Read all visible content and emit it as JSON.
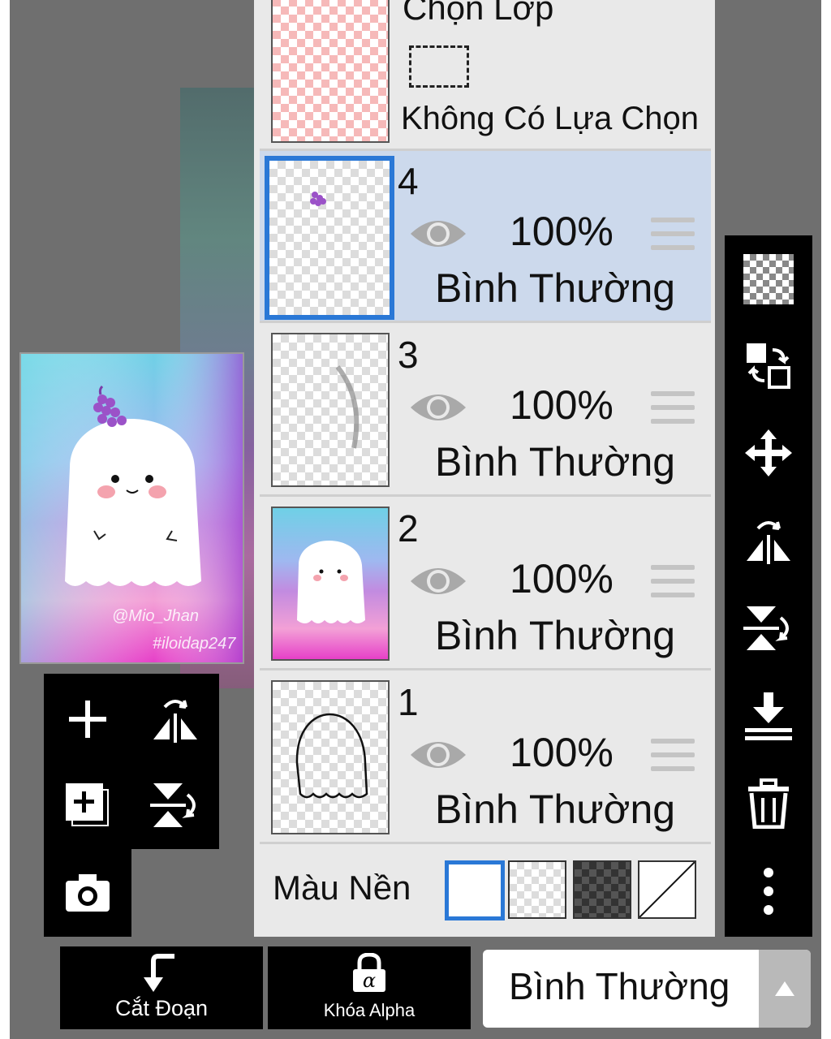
{
  "selection_layer": {
    "title": "Chọn Lớp",
    "status": "Không Có Lựa Chọn"
  },
  "layers": [
    {
      "number": "4",
      "opacity": "100%",
      "blend": "Bình Thường",
      "visible": true,
      "active": true
    },
    {
      "number": "3",
      "opacity": "100%",
      "blend": "Bình Thường",
      "visible": true,
      "active": false
    },
    {
      "number": "2",
      "opacity": "100%",
      "blend": "Bình Thường",
      "visible": true,
      "active": false
    },
    {
      "number": "1",
      "opacity": "100%",
      "blend": "Bình Thường",
      "visible": true,
      "active": false
    }
  ],
  "background_color": {
    "label": "Màu Nền",
    "options": [
      "white",
      "transparent",
      "dark-checker",
      "none"
    ],
    "selected": "white"
  },
  "canvas_preview": {
    "watermark_1": "@Mio_Jhan",
    "watermark_2": "#iloidap247"
  },
  "bottom_bar": {
    "clipping_label": "Cắt Đoạn",
    "alpha_lock_label": "Khóa Alpha",
    "blend_mode_value": "Bình Thường"
  },
  "colors": {
    "accent": "#2a78d6",
    "active_row": "#ccd9ec",
    "panel": "#e9e9e9",
    "toolbar": "#000000"
  },
  "icons": {
    "right_toolbar": [
      "transparent-checker-icon",
      "swap-layers-icon",
      "move-icon",
      "flip-horizontal-icon",
      "flip-vertical-icon",
      "merge-down-icon",
      "trash-icon",
      "more-vertical-icon"
    ],
    "left_toolbar": [
      "add-layer-icon",
      "flip-horizontal-icon",
      "add-duplicate-layer-icon",
      "flip-vertical-icon",
      "camera-icon"
    ]
  }
}
